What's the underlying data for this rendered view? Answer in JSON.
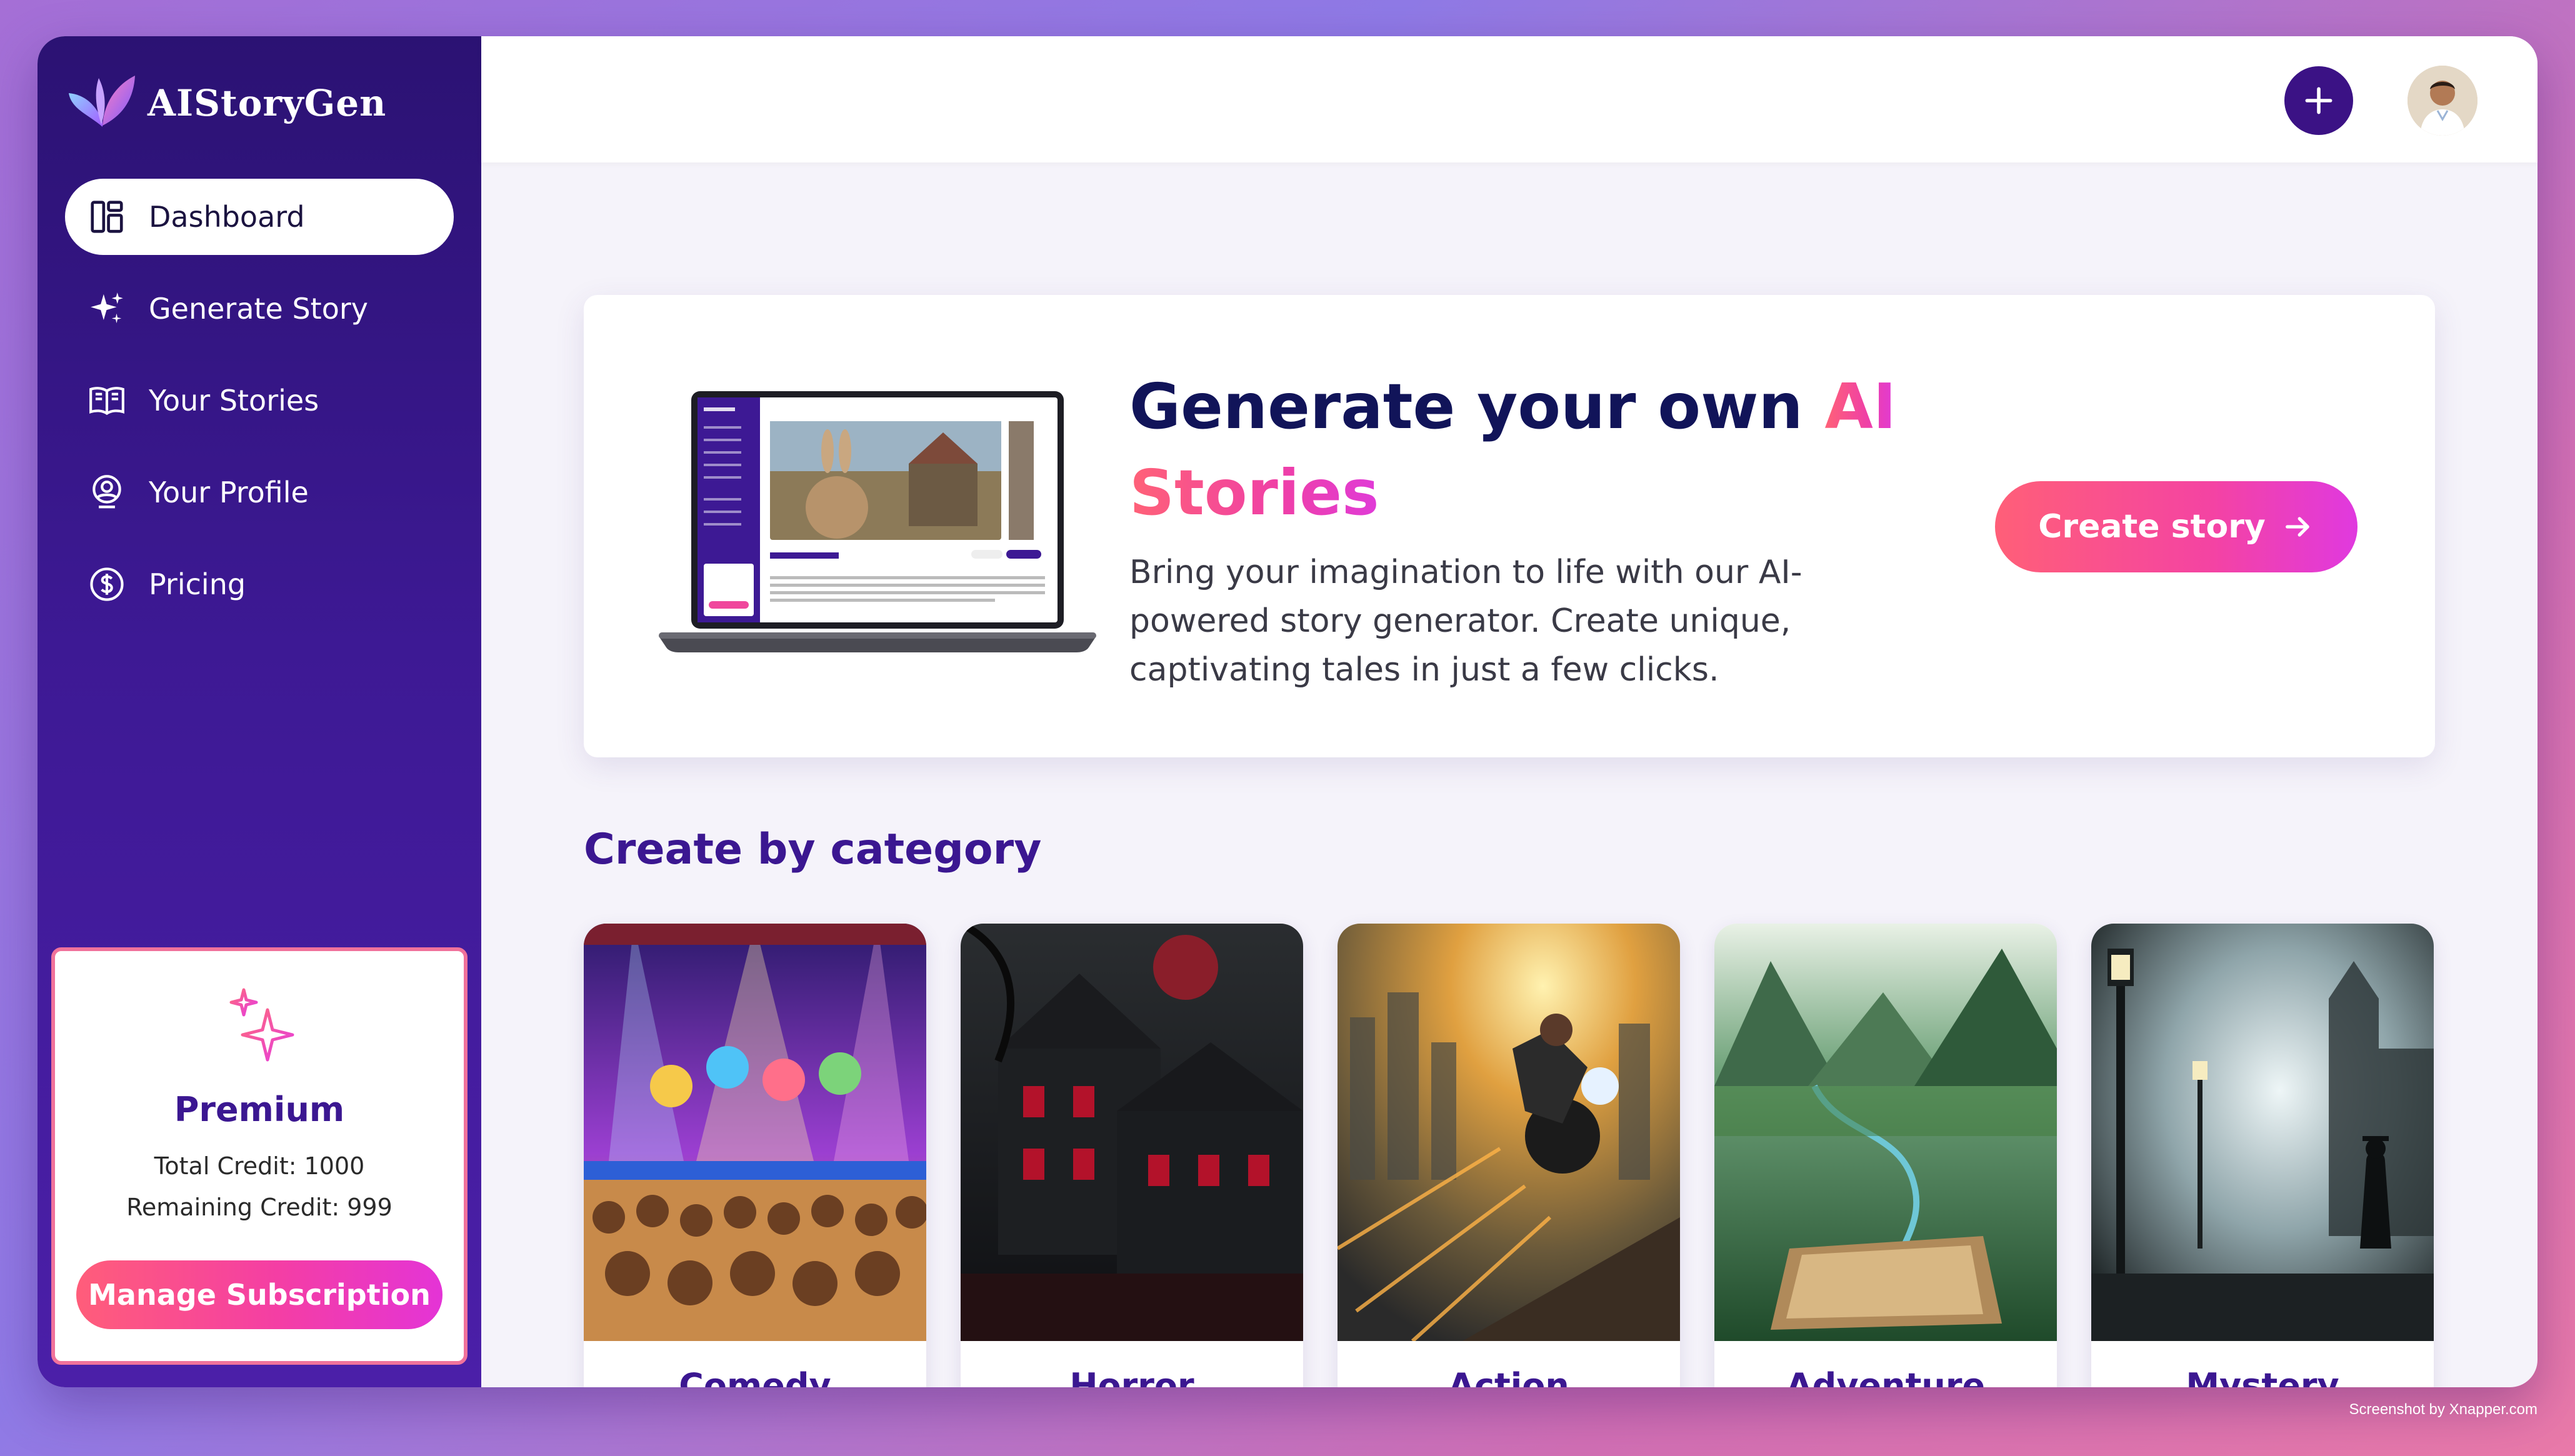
{
  "brand": {
    "name": "AIStoryGen"
  },
  "sidebar": {
    "items": [
      {
        "label": "Dashboard",
        "icon": "dashboard-icon",
        "active": true
      },
      {
        "label": "Generate Story",
        "icon": "sparkles-icon",
        "active": false
      },
      {
        "label": "Your Stories",
        "icon": "book-icon",
        "active": false
      },
      {
        "label": "Your Profile",
        "icon": "user-circle-icon",
        "active": false
      },
      {
        "label": "Pricing",
        "icon": "dollar-icon",
        "active": false
      }
    ],
    "premium": {
      "title": "Premium",
      "total_credit": "Total Credit: 1000",
      "remaining_credit": "Remaining Credit: 999",
      "button": "Manage Subscription"
    }
  },
  "topbar": {
    "add_icon": "plus-icon",
    "avatar_icon": "avatar"
  },
  "hero": {
    "title_start": "Generate your own ",
    "title_highlight_1": "AI",
    "title_highlight_2": "Stories",
    "description": "Bring your imagination to life with our AI-powered story generator. Create unique, captivating tales in just a few clicks.",
    "button": "Create story"
  },
  "categories": {
    "title": "Create by category",
    "items": [
      {
        "label": "Comedy"
      },
      {
        "label": "Horror"
      },
      {
        "label": "Action"
      },
      {
        "label": "Adventure"
      },
      {
        "label": "Mystery"
      }
    ]
  },
  "colors": {
    "sidebar_bg": "#3d1994",
    "accent": "#3b1791",
    "cta_gradient_start": "#ff5f78",
    "cta_gradient_end": "#e039df"
  },
  "watermark": "Screenshot by Xnapper.com"
}
